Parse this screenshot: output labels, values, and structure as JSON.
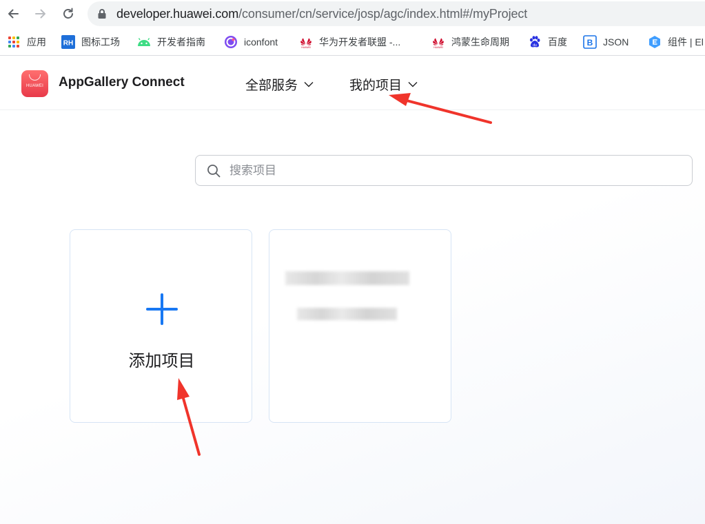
{
  "browser": {
    "url_host": "developer.huawei.com",
    "url_path": "/consumer/cn/service/josp/agc/index.html#/myProject",
    "bookmarks": [
      {
        "label": "应用",
        "icon": "apps-grid-icon"
      },
      {
        "label": "图标工场",
        "icon": "rh-icon"
      },
      {
        "label": "开发者指南",
        "icon": "android-icon"
      },
      {
        "label": "iconfont",
        "icon": "iconfont-icon"
      },
      {
        "label": "华为开发者联盟 -...",
        "icon": "huawei-icon"
      },
      {
        "label": "鸿蒙生命周期",
        "icon": "huawei-icon"
      },
      {
        "label": "百度",
        "icon": "baidu-paw-icon"
      },
      {
        "label": "JSON",
        "icon": "json-icon"
      },
      {
        "label": "组件 | El",
        "icon": "element-icon"
      }
    ]
  },
  "header": {
    "logo_text": "HUAWEI",
    "app_title": "AppGallery Connect",
    "nav": [
      {
        "label": "全部服务"
      },
      {
        "label": "我的项目"
      }
    ]
  },
  "main": {
    "search_placeholder": "搜索项目",
    "add_project_label": "添加项目"
  },
  "colors": {
    "accent": "#1878f3",
    "annotation_arrow": "#f0342b",
    "brand_red": "#e83a4a"
  }
}
